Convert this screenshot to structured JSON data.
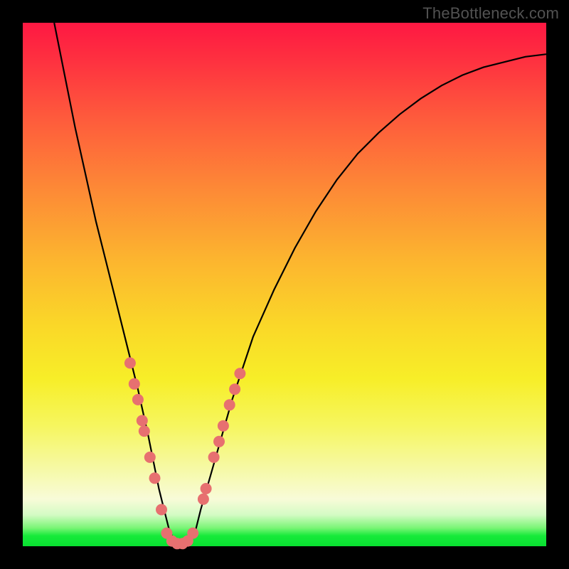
{
  "watermark": "TheBottleneck.com",
  "chart_data": {
    "type": "line",
    "title": "",
    "xlabel": "",
    "ylabel": "",
    "xlim": [
      0,
      100
    ],
    "ylim": [
      0,
      100
    ],
    "grid": false,
    "legend": false,
    "annotations": [],
    "series": [
      {
        "name": "curve",
        "x": [
          6,
          8,
          10,
          12,
          14,
          16,
          18,
          20,
          22,
          24,
          25,
          26,
          27,
          28,
          29,
          30,
          31,
          32,
          33,
          34,
          36,
          38,
          40,
          44,
          48,
          52,
          56,
          60,
          64,
          68,
          72,
          76,
          80,
          84,
          88,
          92,
          96,
          100
        ],
        "y": [
          100,
          90,
          80,
          71,
          62,
          54,
          46,
          38,
          30,
          21,
          16,
          11,
          7,
          3,
          1,
          0.5,
          0.5,
          1,
          3,
          7,
          14,
          21,
          28,
          40,
          49,
          57,
          64,
          70,
          75,
          79,
          82.5,
          85.5,
          88,
          90,
          91.5,
          92.5,
          93.5,
          94
        ]
      }
    ],
    "markers": [
      {
        "x": 20.5,
        "y": 35
      },
      {
        "x": 21.3,
        "y": 31
      },
      {
        "x": 22.0,
        "y": 28
      },
      {
        "x": 22.8,
        "y": 24
      },
      {
        "x": 23.2,
        "y": 22
      },
      {
        "x": 24.3,
        "y": 17
      },
      {
        "x": 25.2,
        "y": 13
      },
      {
        "x": 26.5,
        "y": 7
      },
      {
        "x": 27.5,
        "y": 2.5
      },
      {
        "x": 28.5,
        "y": 1
      },
      {
        "x": 29.5,
        "y": 0.5
      },
      {
        "x": 30.5,
        "y": 0.5
      },
      {
        "x": 31.5,
        "y": 1
      },
      {
        "x": 32.5,
        "y": 2.5
      },
      {
        "x": 34.5,
        "y": 9
      },
      {
        "x": 35.0,
        "y": 11
      },
      {
        "x": 36.5,
        "y": 17
      },
      {
        "x": 37.5,
        "y": 20
      },
      {
        "x": 38.3,
        "y": 23
      },
      {
        "x": 39.5,
        "y": 27
      },
      {
        "x": 40.5,
        "y": 30
      },
      {
        "x": 41.5,
        "y": 33
      }
    ]
  }
}
